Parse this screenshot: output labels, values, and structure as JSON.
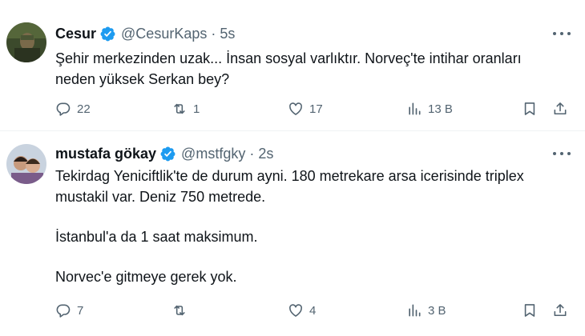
{
  "tweets": [
    {
      "name": "Cesur",
      "handle": "@CesurKaps",
      "separator": "·",
      "time": "5s",
      "text_lines": [
        "Şehir merkezinden uzak... İnsan sosyal varlıktır. Norveç'te intihar oranları\nneden yüksek Serkan bey?"
      ],
      "replies": "22",
      "retweets": "1",
      "likes": "17",
      "views": "13 B"
    },
    {
      "name": "mustafa gökay",
      "handle": "@mstfgky",
      "separator": "·",
      "time": "2s",
      "text_lines": [
        "Tekirdag Yeniciftlik'te de durum ayni. 180 metrekare arsa icerisinde triplex\nmustakil var. Deniz 750 metrede.",
        "İstanbul'a da 1 saat maksimum.",
        "Norvec'e gitmeye gerek yok."
      ],
      "replies": "7",
      "retweets": "",
      "likes": "4",
      "views": "3 B"
    }
  ],
  "colors": {
    "verified": "#1d9bf0",
    "muted": "#536471",
    "text": "#0f1419"
  },
  "icons": [
    "verified-badge-icon",
    "more-icon",
    "reply-icon",
    "retweet-icon",
    "like-icon",
    "views-icon",
    "bookmark-icon",
    "share-icon"
  ]
}
